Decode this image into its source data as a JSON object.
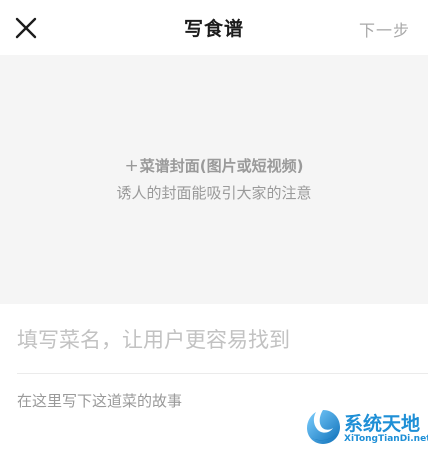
{
  "header": {
    "title": "写食谱",
    "next_label": "下一步"
  },
  "cover": {
    "plus": "+",
    "main_label": "菜谱封面(图片或短视频)",
    "sub_label": "诱人的封面能吸引大家的注意"
  },
  "form": {
    "name_placeholder": "填写菜名，让用户更容易找到",
    "story_placeholder": "在这里写下这道菜的故事"
  },
  "watermark": {
    "brand": "系统天地",
    "domain": "XiTongTianDi.net"
  },
  "colors": {
    "cover_bg": "#f5f5f5",
    "placeholder": "#c2c2c2",
    "watermark": "#1e8fd6"
  }
}
